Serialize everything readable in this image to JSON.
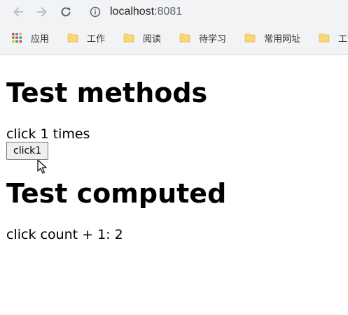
{
  "browser": {
    "url_host": "localhost",
    "url_port": ":8081",
    "bookmarks": [
      {
        "label": "应用",
        "icon": "apps-grid-icon"
      },
      {
        "label": "工作",
        "icon": "folder-icon"
      },
      {
        "label": "阅读",
        "icon": "folder-icon"
      },
      {
        "label": "待学习",
        "icon": "folder-icon"
      },
      {
        "label": "常用网址",
        "icon": "folder-icon"
      },
      {
        "label": "工",
        "icon": "folder-icon"
      }
    ]
  },
  "page": {
    "methods_heading": "Test methods",
    "click_text": "click 1 times",
    "click_button_label": "click1",
    "computed_heading": "Test computed",
    "computed_text": "click count + 1: 2"
  }
}
